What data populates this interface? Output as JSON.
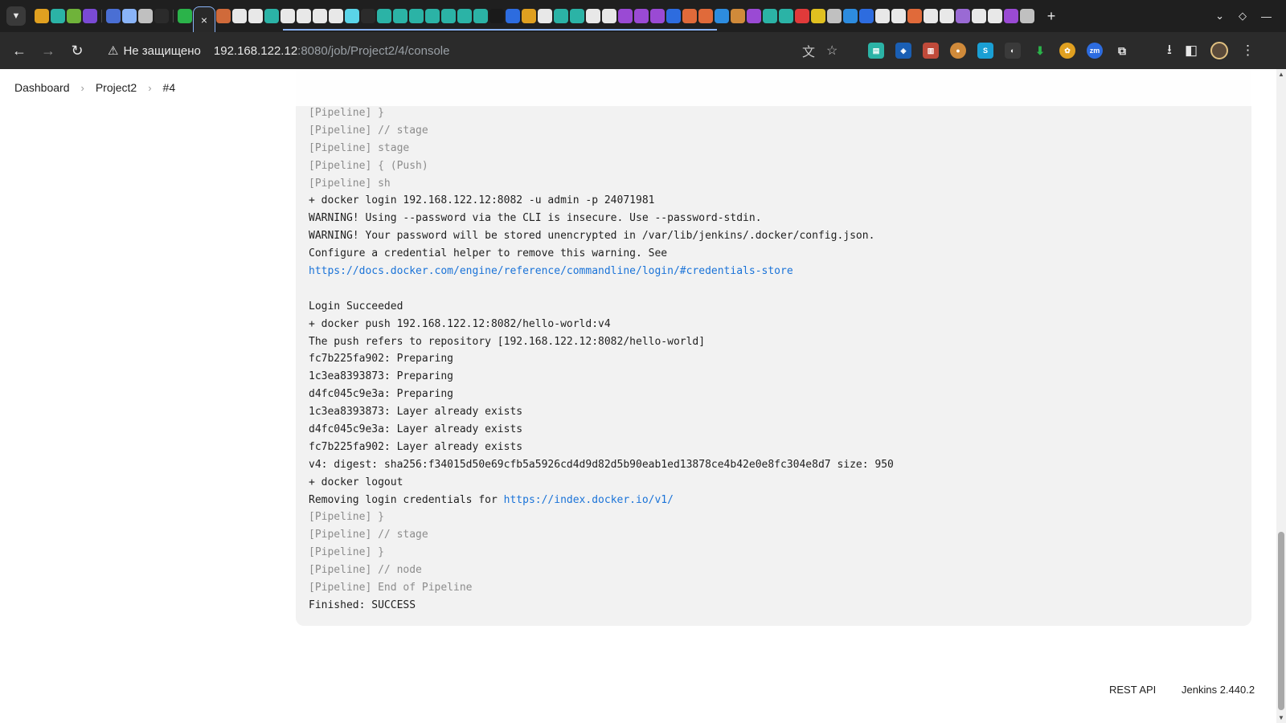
{
  "browser": {
    "tab_menu_icon": "chevron-down-icon",
    "active_tab_close": "×",
    "new_tab": "+",
    "tab_list_icon": "chevron-down-icon",
    "address": {
      "security_text": "Не защищено",
      "url_host": "192.168.122.12",
      "url_rest": ":8080/job/Project2/4/console"
    }
  },
  "breadcrumb": {
    "items": [
      "Dashboard",
      "Project2",
      "#4"
    ],
    "separator": "›"
  },
  "console": {
    "lines": [
      {
        "text": "[Pipeline] }",
        "type": "pipeline"
      },
      {
        "text": "[Pipeline] // stage",
        "type": "pipeline"
      },
      {
        "text": "[Pipeline] stage",
        "type": "pipeline"
      },
      {
        "text": "[Pipeline] { (Push)",
        "type": "pipeline"
      },
      {
        "text": "[Pipeline] sh",
        "type": "pipeline"
      },
      {
        "text": "+ docker login 192.168.122.12:8082 -u admin -p 24071981",
        "type": "output"
      },
      {
        "text": "WARNING! Using --password via the CLI is insecure. Use --password-stdin.",
        "type": "output"
      },
      {
        "text": "WARNING! Your password will be stored unencrypted in /var/lib/jenkins/.docker/config.json.",
        "type": "output"
      },
      {
        "text": "Configure a credential helper to remove this warning. See",
        "type": "output"
      },
      {
        "text": "",
        "link": "https://docs.docker.com/engine/reference/commandline/login/#credentials-store",
        "type": "output"
      },
      {
        "text": "",
        "type": "output"
      },
      {
        "text": "Login Succeeded",
        "type": "output"
      },
      {
        "text": "+ docker push 192.168.122.12:8082/hello-world:v4",
        "type": "output"
      },
      {
        "text": "The push refers to repository [192.168.122.12:8082/hello-world]",
        "type": "output"
      },
      {
        "text": "fc7b225fa902: Preparing",
        "type": "output"
      },
      {
        "text": "1c3ea8393873: Preparing",
        "type": "output"
      },
      {
        "text": "d4fc045c9e3a: Preparing",
        "type": "output"
      },
      {
        "text": "1c3ea8393873: Layer already exists",
        "type": "output"
      },
      {
        "text": "d4fc045c9e3a: Layer already exists",
        "type": "output"
      },
      {
        "text": "fc7b225fa902: Layer already exists",
        "type": "output"
      },
      {
        "text": "v4: digest: sha256:f34015d50e69cfb5a5926cd4d9d82d5b90eab1ed13878ce4b42e0e8fc304e8d7 size: 950",
        "type": "output"
      },
      {
        "text": "+ docker logout",
        "type": "output"
      },
      {
        "text": "Removing login credentials for ",
        "link": "https://index.docker.io/v1/",
        "type": "output"
      },
      {
        "text": "[Pipeline] }",
        "type": "pipeline"
      },
      {
        "text": "[Pipeline] // stage",
        "type": "pipeline"
      },
      {
        "text": "[Pipeline] }",
        "type": "pipeline"
      },
      {
        "text": "[Pipeline] // node",
        "type": "pipeline"
      },
      {
        "text": "[Pipeline] End of Pipeline",
        "type": "pipeline"
      },
      {
        "text": "Finished: SUCCESS",
        "type": "output"
      }
    ]
  },
  "footer": {
    "rest_api": "REST API",
    "version": "Jenkins 2.440.2"
  },
  "colors": {
    "link": "#1a73d8",
    "pipeline_text": "#8c8c8c",
    "console_bg": "#f2f2f2",
    "browser_frame": "#1f1f1f",
    "accent": "#8ab4f8"
  }
}
